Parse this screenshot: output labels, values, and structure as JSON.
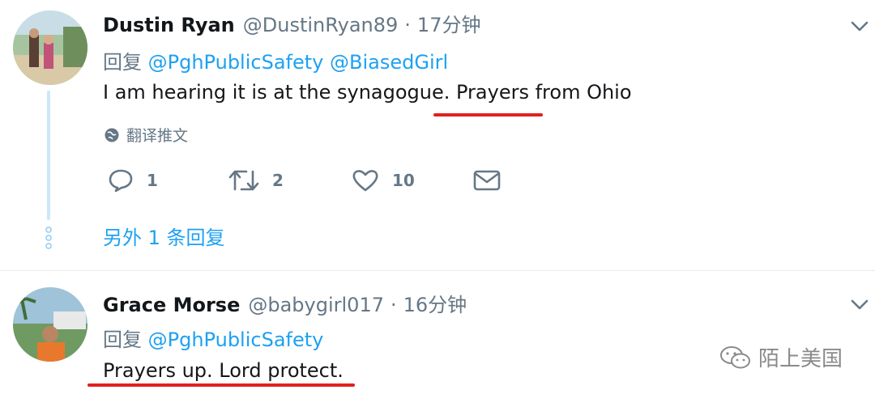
{
  "tweets": [
    {
      "name": "Dustin Ryan",
      "handle": "@DustinRyan89",
      "separator": "·",
      "time": "17分钟",
      "reply_prefix": "回复",
      "mentions": [
        "@PghPublicSafety",
        "@BiasedGirl"
      ],
      "text_before": "I am hearing it is at the synagogue. ",
      "text_highlight": "Prayers from Ohio",
      "translate_label": "翻译推文",
      "actions": {
        "reply_count": "1",
        "retweet_count": "2",
        "like_count": "10"
      },
      "more_replies": "另外 1 条回复"
    },
    {
      "name": "Grace Morse",
      "handle": "@babygirl017",
      "separator": "·",
      "time": "16分钟",
      "reply_prefix": "回复",
      "mentions": [
        "@PghPublicSafety"
      ],
      "text": "Prayers up. Lord protect."
    }
  ],
  "watermark": {
    "text": "陌上美国"
  },
  "colors": {
    "accent": "#1da1f2",
    "muted": "#657786",
    "annotation": "#e02020"
  }
}
